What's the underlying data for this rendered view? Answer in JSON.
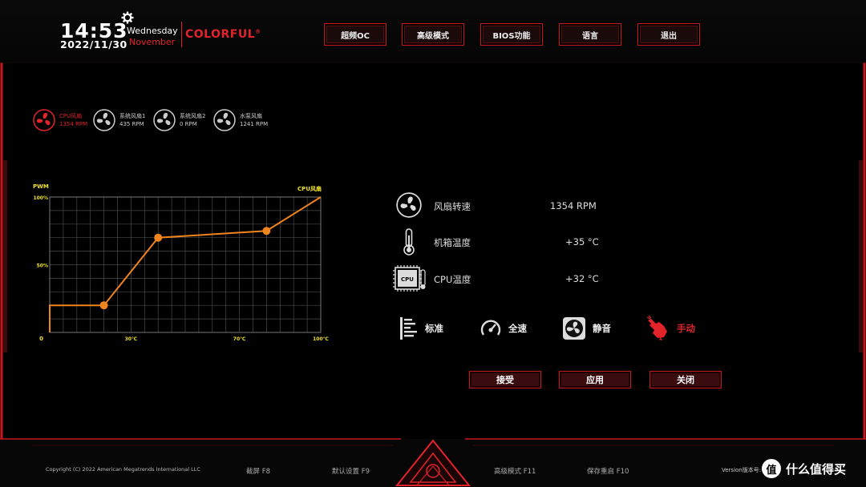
{
  "header": {
    "time": "14:53",
    "date": "2022/11/30",
    "weekday": "Wednesday",
    "month": "November",
    "brand": "COLORFUL",
    "brand_mark": "®",
    "nav": [
      "超频OC",
      "高级模式",
      "BIOS功能",
      "语言",
      "退出"
    ]
  },
  "fans": [
    {
      "name": "CPU风扇",
      "rpm": "1354 RPM",
      "active": true
    },
    {
      "name": "系统风扇1",
      "rpm": "435 RPM",
      "active": false
    },
    {
      "name": "系统风扇2",
      "rpm": "0 RPM",
      "active": false
    },
    {
      "name": "水泵风扇",
      "rpm": "1241 RPM",
      "active": false
    }
  ],
  "info": {
    "fan_speed_label": "风扇转速",
    "fan_speed_value": "1354 RPM",
    "case_temp_label": "机箱温度",
    "case_temp_value": "+35 °C",
    "cpu_temp_label": "CPU温度",
    "cpu_temp_value": "+32 °C",
    "cpu_chip_text": "CPU"
  },
  "modes": [
    {
      "label": "标准",
      "icon": "bars-icon",
      "active": false
    },
    {
      "label": "全速",
      "icon": "speedometer-icon",
      "active": false
    },
    {
      "label": "静音",
      "icon": "fan-box-icon",
      "active": false
    },
    {
      "label": "手动",
      "icon": "hand-pointer-icon",
      "active": true
    }
  ],
  "actions": {
    "accept": "接受",
    "apply": "应用",
    "close": "关闭"
  },
  "footer": {
    "copyright": "Copyright (C) 2022 American Megatrends International LLC",
    "screenshot": "截屏 F8",
    "defaults": "默认设置 F9",
    "advanced": "高级模式 F11",
    "save_reboot": "保存重启 F10",
    "version": "Version版本号: ",
    "watermark_logo": "值",
    "watermark_text": "什么值得买"
  },
  "colors": {
    "accent": "#e2232a",
    "curve": "#f0851e",
    "label_yellow": "#f2e21c",
    "grid": "#4a4a4a"
  },
  "chart_data": {
    "type": "line",
    "title": "CPU风扇",
    "ylabel": "PWM",
    "xlim": [
      0,
      100
    ],
    "ylim": [
      0,
      100
    ],
    "y_ticks": [
      {
        "v": 50,
        "label": "50%"
      },
      {
        "v": 100,
        "label": "100%"
      }
    ],
    "y_zero_label": "0",
    "x_ticks": [
      {
        "v": 30,
        "label": "30℃"
      },
      {
        "v": 70,
        "label": "70℃"
      },
      {
        "v": 100,
        "label": "100℃"
      }
    ],
    "grid": true,
    "series": [
      {
        "values": [
          [
            0,
            0
          ],
          [
            0,
            20
          ],
          [
            20,
            20
          ],
          [
            40,
            70
          ],
          [
            80,
            75
          ],
          [
            100,
            100
          ]
        ]
      }
    ],
    "control_points": [
      [
        20,
        20
      ],
      [
        40,
        70
      ],
      [
        80,
        75
      ]
    ]
  }
}
